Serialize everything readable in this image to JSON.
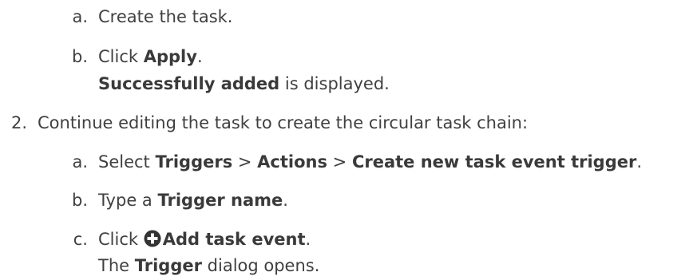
{
  "steps": {
    "s1a": {
      "marker": "a.",
      "text": "Create the task."
    },
    "s1b": {
      "marker": "b.",
      "pre": "Click ",
      "bold": "Apply",
      "post": "."
    },
    "s1b_result": {
      "bold": "Successfully added",
      "post": " is displayed."
    },
    "s2": {
      "marker": "2.",
      "text": "Continue editing the task to create the circular task chain:"
    },
    "s2a": {
      "marker": "a.",
      "pre": "Select ",
      "b1": "Triggers",
      "sep1": " > ",
      "b2": "Actions",
      "sep2": " > ",
      "b3": "Create new task event trigger",
      "post": "."
    },
    "s2b": {
      "marker": "b.",
      "pre": "Type a ",
      "bold": "Trigger name",
      "post": "."
    },
    "s2c": {
      "marker": "c.",
      "pre": "Click ",
      "icon": "plus-circle-icon",
      "bold": "Add task event",
      "post": "."
    },
    "s2c_result": {
      "pre": "The ",
      "bold": "Trigger",
      "post": " dialog opens."
    }
  }
}
